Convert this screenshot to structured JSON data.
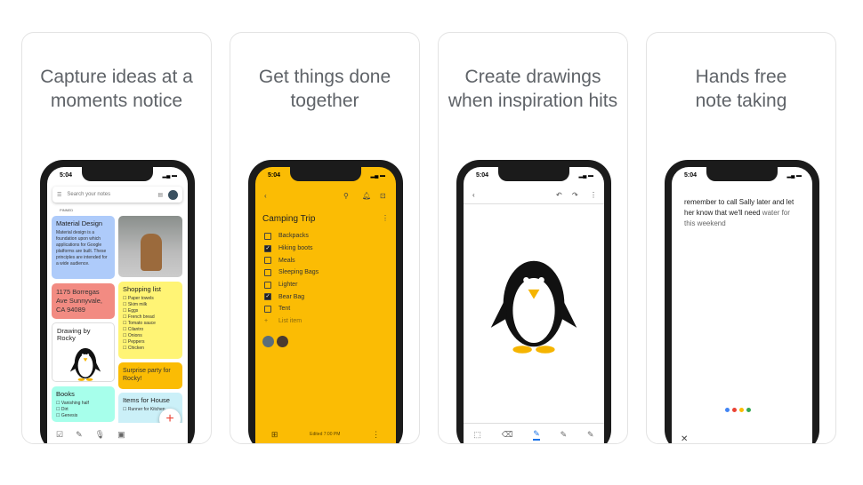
{
  "panels": [
    {
      "caption": [
        "Capture ideas at a",
        "moments notice"
      ]
    },
    {
      "caption": [
        "Get things done",
        "together"
      ]
    },
    {
      "caption": [
        "Create drawings",
        "when inspiration hits"
      ]
    },
    {
      "caption": [
        "Hands free",
        "note taking"
      ]
    }
  ],
  "status": {
    "time": "5:04"
  },
  "notes_screen": {
    "search_placeholder": "Search your notes",
    "pinned_label": "PINNED",
    "material": {
      "title": "Material Design",
      "body": "Material design is a foundation upon which applications for Google platforms are built. These principles are intended for a wide audience."
    },
    "address": "1175 Borregas Ave Sunnyvale, CA 94089",
    "shopping": {
      "title": "Shopping list",
      "items": [
        "Paper towels",
        "Skim milk",
        "Eggs",
        "French bread",
        "Tomato sauce",
        "Cilantro",
        "Onions",
        "Peppers",
        "Chicken"
      ]
    },
    "drawing_title": "Drawing by Rocky",
    "surprise": "Surprise party for Rocky!",
    "books": {
      "title": "Books",
      "items": [
        "Vanishing half",
        "Dirt",
        "Genesis"
      ]
    },
    "house": {
      "title": "Items for House",
      "items": [
        "Runner for Kitchen"
      ]
    },
    "colors": {
      "blue": "#aecbfa",
      "red": "#f28b82",
      "yellow": "#fff475",
      "orange": "#fbbc04",
      "teal": "#a7ffeb",
      "lightblue": "#cbf0f8"
    }
  },
  "list_screen": {
    "title": "Camping Trip",
    "items": [
      {
        "label": "Backpacks",
        "checked": false
      },
      {
        "label": "Hiking boots",
        "checked": true
      },
      {
        "label": "Meals",
        "checked": false
      },
      {
        "label": "Sleeping Bags",
        "checked": false
      },
      {
        "label": "Lighter",
        "checked": false
      },
      {
        "label": "Bear Bag",
        "checked": true
      },
      {
        "label": "Tent",
        "checked": false
      }
    ],
    "add_placeholder": "List item",
    "edited": "Edited 7:00 PM",
    "bg": "#fbbc04"
  },
  "voice_screen": {
    "text_dark": "remember to call Sally later and let her know that we'll need",
    "text_light": " water for this weekend"
  }
}
